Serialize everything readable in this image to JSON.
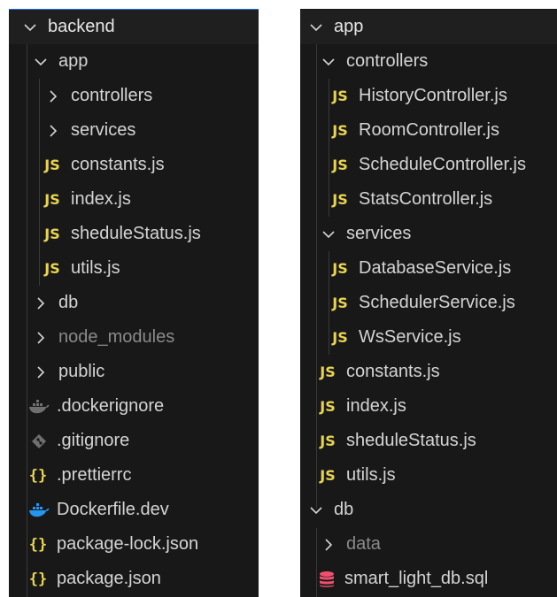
{
  "left_panel": {
    "root": "backend",
    "app": "app",
    "controllers": "controllers",
    "services": "services",
    "constants": "constants.js",
    "index": "index.js",
    "sheduleStatus": "sheduleStatus.js",
    "utils": "utils.js",
    "db": "db",
    "node_modules": "node_modules",
    "public": "public",
    "dockerignore": ".dockerignore",
    "gitignore": ".gitignore",
    "prettierrc": ".prettierrc",
    "dockerfile": "Dockerfile.dev",
    "package_lock": "package-lock.json",
    "package": "package.json"
  },
  "right_panel": {
    "app": "app",
    "controllers": "controllers",
    "history": "HistoryController.js",
    "room": "RoomController.js",
    "schedule": "ScheduleController.js",
    "stats": "StatsController.js",
    "services": "services",
    "database": "DatabaseService.js",
    "scheduler": "SchedulerService.js",
    "ws": "WsService.js",
    "constants": "constants.js",
    "index": "index.js",
    "sheduleStatus": "sheduleStatus.js",
    "utils": "utils.js",
    "db": "db",
    "data": "data",
    "sql": "smart_light_db.sql"
  },
  "badges": {
    "js": "JS",
    "json": "{}"
  },
  "icons": {
    "expanded": "chevron-down-icon",
    "collapsed": "chevron-right-icon",
    "js": "javascript-file-icon",
    "json": "json-file-icon",
    "docker": "docker-whale-icon",
    "git": "git-diamond-icon",
    "database": "database-icon"
  },
  "colors": {
    "panel_bg": "#181818",
    "header_bg": "#1f1f1f",
    "accent": "#1f6feb",
    "js_yellow": "#e8d44d",
    "text": "#d4d4d4",
    "dimmed_text": "#8a8a8a",
    "docker_blue": "#2496ed",
    "database_pink": "#f0506e"
  }
}
